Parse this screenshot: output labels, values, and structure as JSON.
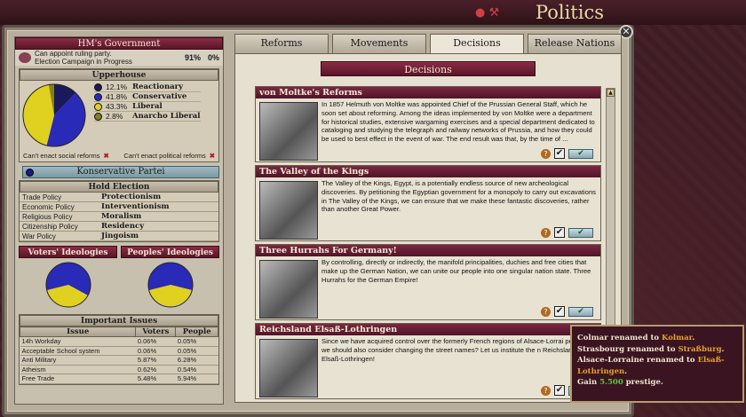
{
  "screen": {
    "title": "Politics"
  },
  "government": {
    "header": "HM's Government",
    "line1": "Can appoint ruling party.",
    "line2": "Election Campaign in Progress",
    "stat1": "91%",
    "stat2": "0%"
  },
  "upperhouse": {
    "header": "Upperhouse",
    "parties": [
      {
        "pct": "12.1%",
        "name": "Reactionary",
        "color": "#1a1a5a",
        "share": 12.1
      },
      {
        "pct": "41.8%",
        "name": "Conservative",
        "color": "#2a2ab8",
        "share": 41.8
      },
      {
        "pct": "43.3%",
        "name": "Liberal",
        "color": "#e0d020",
        "share": 43.3
      },
      {
        "pct": "2.8%",
        "name": "Anarcho Liberal",
        "color": "#8a7a20",
        "share": 2.8
      }
    ]
  },
  "cant": {
    "social": "Can't enact social reforms",
    "political": "Can't enact political reforms"
  },
  "ruling_party": {
    "name": "Konservative Partei",
    "hold_election": "Hold Election",
    "policies": [
      {
        "k": "Trade Policy",
        "v": "Protectionism"
      },
      {
        "k": "Economic Policy",
        "v": "Interventionism"
      },
      {
        "k": "Religious Policy",
        "v": "Moralism"
      },
      {
        "k": "Citizenship Policy",
        "v": "Residency"
      },
      {
        "k": "War Policy",
        "v": "Jingoism"
      }
    ]
  },
  "ideologies": {
    "voters": "Voters' Ideologies",
    "peoples": "Peoples' Ideologies"
  },
  "issues": {
    "header": "Important Issues",
    "cols": [
      "Issue",
      "Voters",
      "People"
    ],
    "rows": [
      [
        "14h Workday",
        "0.06%",
        "0.05%"
      ],
      [
        "Acceptable School system",
        "0.06%",
        "0.05%"
      ],
      [
        "Anti Military",
        "5.87%",
        "6.28%"
      ],
      [
        "Atheism",
        "0.62%",
        "0.54%"
      ],
      [
        "Free Trade",
        "5.48%",
        "5.94%"
      ]
    ]
  },
  "tabs": [
    "Reforms",
    "Movements",
    "Decisions",
    "Release Nations"
  ],
  "decisions": {
    "header": "Decisions",
    "items": [
      {
        "title": "von Moltke's Reforms",
        "text": "In 1857 Helmuth von Moltke was appointed Chief of the Prussian General Staff, which he soon set about reforming. Among the ideas implemented by von Moltke were a department for historical studies, extensive wargaming exercises and a special department dedicated to cataloging and studying the telegraph and railway networks of Prussia, and how they could be used to best effect in the event of war. The end result was that, by the time of  ..."
      },
      {
        "title": "The Valley of the Kings",
        "text": "The Valley of the Kings, Egypt, is a potentially endless source of new archeological discoveries. By petitioning the Egyptian government for a monopoly to carry out excavations in The Valley of the Kings, we can ensure that we make these fantastic discoveries, rather than another Great Power."
      },
      {
        "title": "Three Hurrahs For Germany!",
        "text": "By controlling, directly or indirectly, the manifold principalities, duchies and free cities that make up the German Nation, we can unite our people into one singular nation state. Three Hurrahs for the German Empire!"
      },
      {
        "title": "Reichsland Elsaß-Lothringen",
        "text": "Since we have acquired control over the formerly French regions of Alsace-Lorrai perhaps we should also consider changing the street names? Let us institute the n Reichsland of Elsaß-Lothringen!"
      }
    ]
  },
  "tooltip": {
    "l1a": "Colmar renamed to ",
    "l1b": "Kolmar",
    "l2a": "Strasbourg renamed to ",
    "l2b": "Straßburg",
    "l3a": "Alsace-Lorraine renamed to ",
    "l3b": "Elsaß-Lothringen",
    "l4a": "Gain ",
    "l4b": "5.500",
    "l4c": " prestige."
  }
}
